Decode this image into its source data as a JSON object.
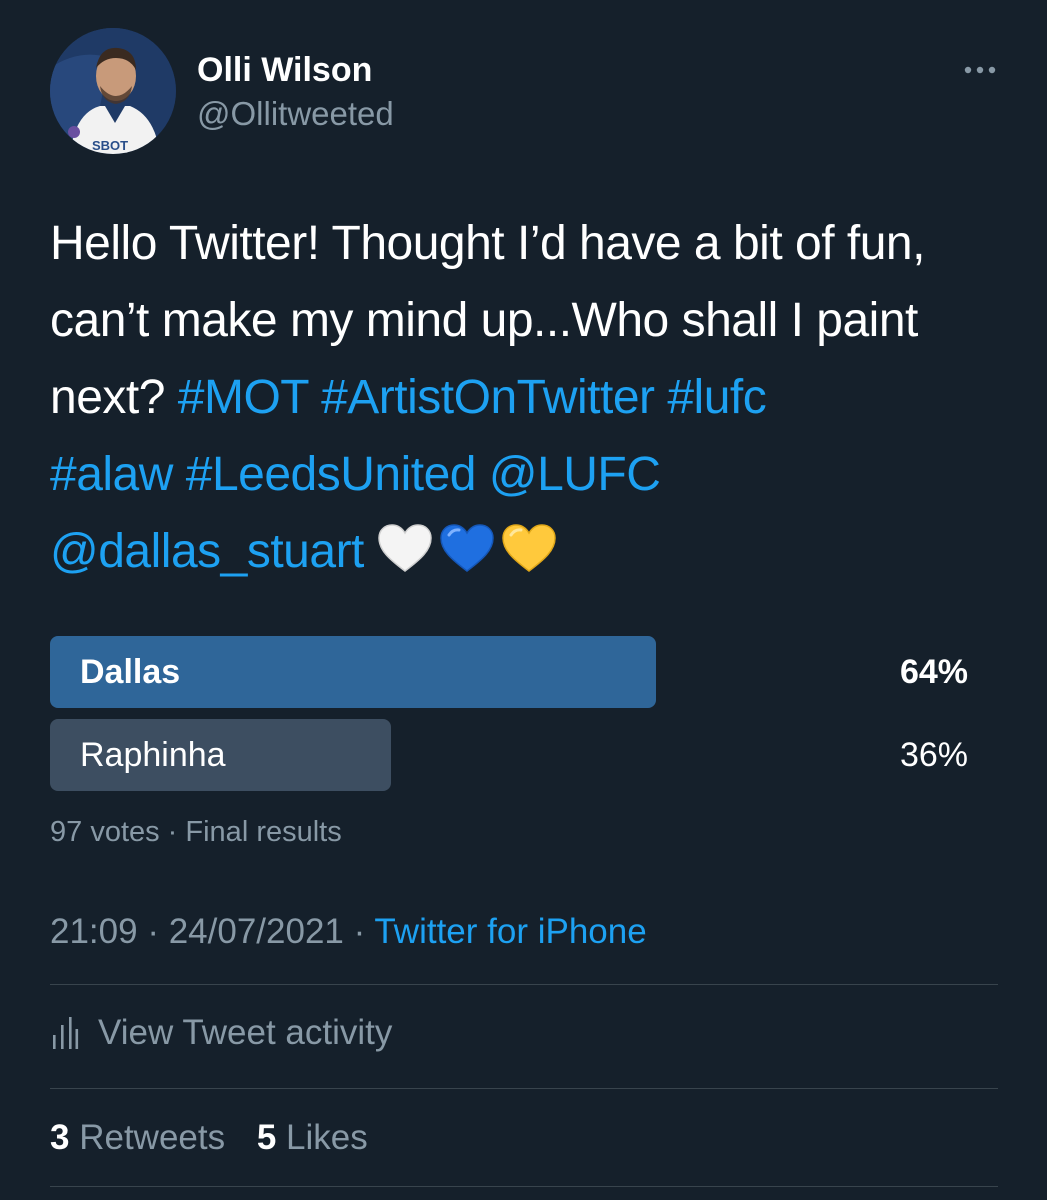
{
  "author": {
    "name": "Olli Wilson",
    "handle": "@Ollitweeted",
    "avatar_icon": "profile-photo-footballer"
  },
  "tweet": {
    "text_parts": {
      "intro": "Hello Twitter! Thought I’d have a bit of fun, can’t make my mind up...Who shall I paint next? ",
      "hashtag_1": "#MOT",
      "hashtag_2": "#ArtistOnTwitter",
      "hashtag_3": "#lufc",
      "hashtag_4": "#alaw",
      "hashtag_5": "#LeedsUnited",
      "mention_1": "@LUFC",
      "mention_2": "@dallas_stuart"
    },
    "emojis": [
      "white-heart-icon",
      "blue-heart-icon",
      "yellow-heart-icon"
    ]
  },
  "poll": {
    "options": [
      {
        "label": "Dallas",
        "percent_text": "64%",
        "percent": 64,
        "winner": true
      },
      {
        "label": "Raphinha",
        "percent_text": "36%",
        "percent": 36,
        "winner": false
      }
    ],
    "meta": "97 votes · Final results"
  },
  "meta": {
    "time": "21:09",
    "date": "24/07/2021",
    "separator": " · ",
    "source": "Twitter for iPhone"
  },
  "activity": {
    "label": "View Tweet activity",
    "icon": "bar-chart-icon"
  },
  "stats": {
    "retweets_count": "3",
    "retweets_label": "Retweets",
    "likes_count": "5",
    "likes_label": "Likes"
  },
  "colors": {
    "background": "#15202b",
    "link": "#1da1f2",
    "secondary_text": "#8899a6",
    "poll_winner": "#2f6699",
    "poll_loser": "#3d4e61"
  }
}
